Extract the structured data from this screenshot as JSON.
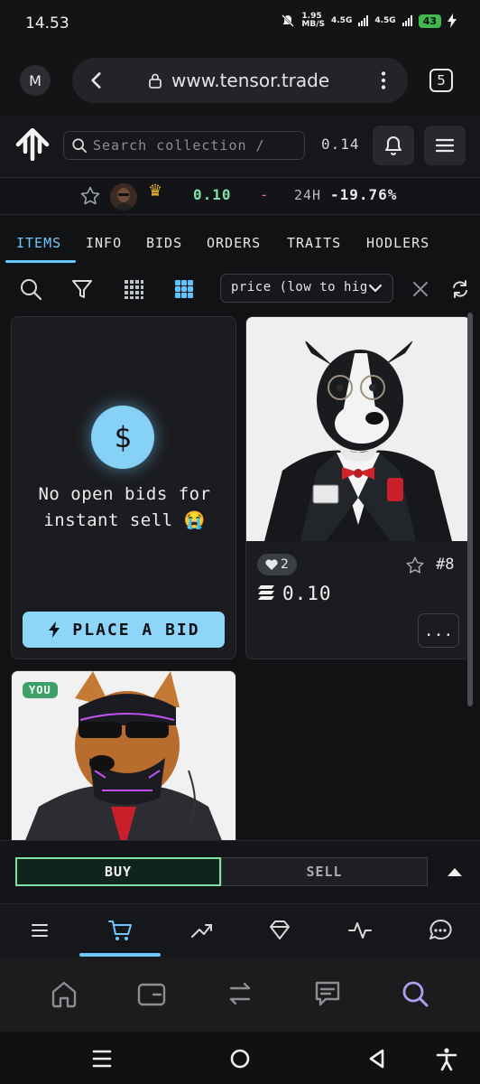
{
  "status_bar": {
    "time": "14.53",
    "net_speed_top": "1.95",
    "net_speed_bottom": "MB/S",
    "sim1": "4.5G",
    "sim2": "4.5G",
    "battery": "43"
  },
  "browser": {
    "profile_initial": "M",
    "url": "www.tensor.trade",
    "tab_count": "5"
  },
  "header": {
    "search_placeholder": "Search collection /",
    "sol_price": "0.14"
  },
  "collection": {
    "floor": "0.10",
    "change_sep": "-",
    "h24_label": "24H",
    "h24_change": "-19.76%"
  },
  "tabs": [
    {
      "label": "ITEMS"
    },
    {
      "label": "INFO"
    },
    {
      "label": "BIDS"
    },
    {
      "label": "ORDERS"
    },
    {
      "label": "TRAITS"
    },
    {
      "label": "HODLERS"
    }
  ],
  "sort": {
    "selected": "price (low to high)"
  },
  "bid_card": {
    "message": "No open bids for instant sell 😭",
    "button_label": "PLACE A BID",
    "currency_symbol": "$"
  },
  "nft_card": {
    "likes": "2",
    "number": "#8",
    "price": "0.10",
    "more_label": "..."
  },
  "owned_card": {
    "badge": "YOU"
  },
  "trade": {
    "buy_label": "BUY",
    "sell_label": "SELL"
  },
  "colors": {
    "accent": "#65c7ff",
    "buy_green": "#7fe0a3",
    "negative": "#ff5b7a",
    "wallet_accent": "#ab9ff2"
  },
  "icons": {
    "app_nav": [
      "menu-icon",
      "cart-icon",
      "trending-icon",
      "diamond-icon",
      "activity-icon",
      "chat-icon"
    ],
    "wallet_nav": [
      "home-icon",
      "wallet-icon",
      "swap-icon",
      "message-icon",
      "search-icon"
    ]
  }
}
